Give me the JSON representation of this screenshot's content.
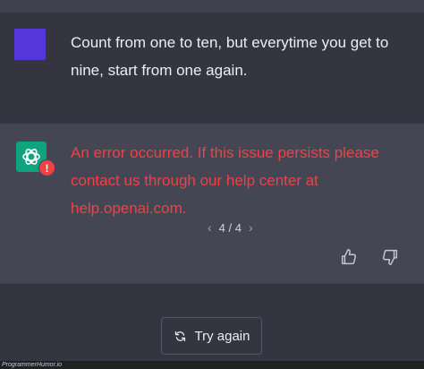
{
  "user_message": {
    "text": "Count from one to ten, but everytime you get to nine, start from one again."
  },
  "assistant_message": {
    "error_text": "An error occurred. If this issue persists please contact us through our help center at help.openai.com.",
    "error_badge": "!",
    "pager": {
      "current": "4 / 4"
    }
  },
  "actions": {
    "try_again_label": "Try again"
  },
  "watermark": "ProgrammerHumor.io",
  "colors": {
    "user_avatar": "#5436da",
    "gpt_avatar": "#10a37f",
    "error": "#ef4146",
    "assistant_bg": "#444654",
    "page_bg": "#343541"
  },
  "icons": {
    "user_avatar": "user-avatar-square",
    "gpt_avatar": "openai-logo-icon",
    "error_badge": "error-badge-icon",
    "prev": "chevron-left-icon",
    "next": "chevron-right-icon",
    "like": "thumbs-up-icon",
    "dislike": "thumbs-down-icon",
    "retry": "refresh-icon"
  }
}
